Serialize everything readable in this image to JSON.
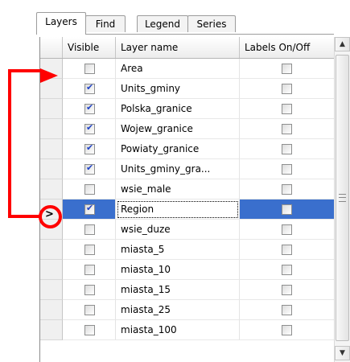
{
  "tabs": [
    {
      "label": "Layers",
      "active": true
    },
    {
      "label": "Find",
      "active": false
    },
    {
      "label": "Legend",
      "active": false
    },
    {
      "label": "Series",
      "active": false
    }
  ],
  "columns": {
    "visible": "Visible",
    "name": "Layer name",
    "labels": "Labels On/Off"
  },
  "rows": [
    {
      "name": "Area",
      "visible": false,
      "labels": false
    },
    {
      "name": "Units_gminy",
      "visible": true,
      "labels": false
    },
    {
      "name": "Polska_granice",
      "visible": true,
      "labels": false
    },
    {
      "name": "Wojew_granice",
      "visible": true,
      "labels": false
    },
    {
      "name": "Powiaty_granice",
      "visible": true,
      "labels": false
    },
    {
      "name": "Units_gminy_gra...",
      "visible": true,
      "labels": false
    },
    {
      "name": "wsie_male",
      "visible": false,
      "labels": false
    },
    {
      "name": "Region",
      "visible": true,
      "labels": false,
      "selected": true
    },
    {
      "name": "wsie_duze",
      "visible": false,
      "labels": false
    },
    {
      "name": "miasta_5",
      "visible": false,
      "labels": false
    },
    {
      "name": "miasta_10",
      "visible": false,
      "labels": false
    },
    {
      "name": "miasta_15",
      "visible": false,
      "labels": false
    },
    {
      "name": "miasta_25",
      "visible": false,
      "labels": false
    },
    {
      "name": "miasta_100",
      "visible": false,
      "labels": false
    }
  ],
  "current_row_marker": ">",
  "scroll": {
    "up": "▲",
    "down": "▼"
  },
  "colors": {
    "annotation": "#ff0000",
    "selection": "#3a6fcd",
    "check": "#2143c5"
  }
}
